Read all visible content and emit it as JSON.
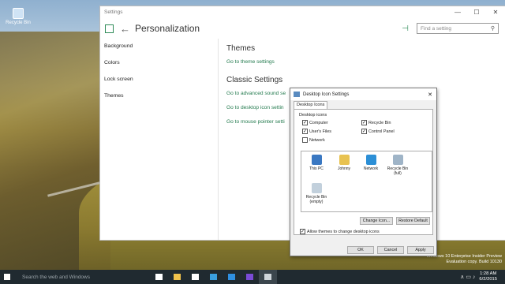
{
  "desktop": {
    "recycle_bin_label": "Recycle Bin"
  },
  "watermark": {
    "line1": "Windows 10 Enterprise Insider Preview",
    "line2": "Evaluation copy. Build 10130"
  },
  "settings": {
    "window_title": "Settings",
    "controls": {
      "minimize": "—",
      "maximize": "☐",
      "close": "✕"
    },
    "back_glyph": "←",
    "page_title": "Personalization",
    "pin_glyph": "⊣",
    "search_placeholder": "Find a setting",
    "search_icon": "search-icon",
    "sidebar": [
      "Background",
      "Colors",
      "Lock screen",
      "Themes"
    ],
    "themes_heading": "Themes",
    "theme_settings_link": "Go to theme settings",
    "classic_heading": "Classic Settings",
    "classic_links": [
      "Go to advanced sound se",
      "Go to desktop icon settin",
      "Go to mouse pointer setti"
    ]
  },
  "dialog": {
    "title": "Desktop Icon Settings",
    "close": "✕",
    "tab": "Desktop Icons",
    "group_label": "Desktop icons",
    "checkboxes": [
      {
        "label": "Computer",
        "checked": "✓"
      },
      {
        "label": "Recycle Bin",
        "checked": "✓"
      },
      {
        "label": "User's Files",
        "checked": "✓"
      },
      {
        "label": "Control Panel",
        "checked": "✓"
      },
      {
        "label": "Network",
        "checked": ""
      }
    ],
    "icons": [
      {
        "label": "This PC",
        "color": "#3a78c2"
      },
      {
        "label": "Johnny",
        "color": "#e8c250"
      },
      {
        "label": "Network",
        "color": "#2c8fd6"
      },
      {
        "label": "Recycle Bin\n(full)",
        "color": "#9fb4c7"
      },
      {
        "label": "Recycle Bin\n(empty)",
        "color": "#c2d0dc"
      }
    ],
    "change_icon": "Change Icon...",
    "restore_default": "Restore Default",
    "allow_themes": "Allow themes to change desktop icons",
    "allow_checked": "✓",
    "ok": "OK",
    "cancel": "Cancel",
    "apply": "Apply"
  },
  "taskbar": {
    "search_placeholder": "Search the web and Windows",
    "apps": [
      {
        "name": "task-view-icon",
        "color": "#ffffff"
      },
      {
        "name": "file-explorer-icon",
        "color": "#f0c24c"
      },
      {
        "name": "store-icon",
        "color": "#ffffff"
      },
      {
        "name": "mail-icon",
        "color": "#3aa0e0"
      },
      {
        "name": "edge-icon",
        "color": "#2f8fe0"
      },
      {
        "name": "media-icon",
        "color": "#7a4bd6"
      },
      {
        "name": "settings-app-icon",
        "color": "#cfd6db"
      }
    ],
    "tray_symbols": "∧ ▭ ♪",
    "time": "1:28 AM",
    "date": "6/2/2015"
  }
}
